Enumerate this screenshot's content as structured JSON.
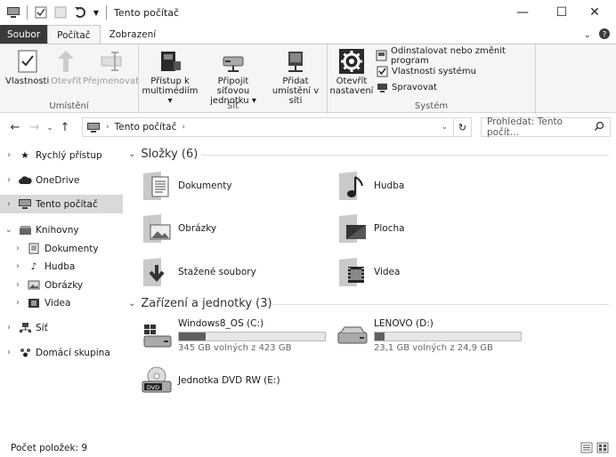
{
  "window": {
    "title": "Tento počítač"
  },
  "ribbon_tabs": [
    "Soubor",
    "Počítač",
    "Zobrazení"
  ],
  "ribbon": {
    "location_group": {
      "label": "Umístění",
      "properties": "Vlastnosti",
      "open": "Otevřít",
      "rename": "Přejmenovat"
    },
    "network_group": {
      "label": "Síť",
      "media_access_l1": "Přístup k",
      "media_access_l2": "multimédiím",
      "map_drive_l1": "Připojit síťovou",
      "map_drive_l2": "jednotku",
      "add_location_l1": "Přidat",
      "add_location_l2": "umístění v síti"
    },
    "system_group": {
      "label": "Systém",
      "open_settings_l1": "Otevřít",
      "open_settings_l2": "nastavení",
      "uninstall": "Odinstalovat nebo změnit program",
      "system_properties": "Vlastnosti systému",
      "manage": "Spravovat"
    }
  },
  "address": {
    "path": "Tento počítač",
    "search_placeholder": "Prohledat: Tento počít..."
  },
  "nav_pane": {
    "items": [
      {
        "label": "Rychlý přístup",
        "icon": "star-icon"
      },
      {
        "label": "OneDrive",
        "icon": "cloud-icon"
      },
      {
        "label": "Tento počítač",
        "icon": "computer-icon"
      },
      {
        "label": "Knihovny",
        "icon": "library-icon"
      },
      {
        "label": "Dokumenty",
        "icon": "documents-icon"
      },
      {
        "label": "Hudba",
        "icon": "music-icon"
      },
      {
        "label": "Obrázky",
        "icon": "pictures-icon"
      },
      {
        "label": "Videa",
        "icon": "videos-icon"
      },
      {
        "label": "Síť",
        "icon": "network-icon"
      },
      {
        "label": "Domácí skupina",
        "icon": "homegroup-icon"
      }
    ]
  },
  "folders_section": {
    "header": "Složky (6)",
    "items": [
      {
        "label": "Dokumenty",
        "icon": "documents-folder-icon"
      },
      {
        "label": "Hudba",
        "icon": "music-folder-icon"
      },
      {
        "label": "Obrázky",
        "icon": "pictures-folder-icon"
      },
      {
        "label": "Plocha",
        "icon": "desktop-folder-icon"
      },
      {
        "label": "Stažené soubory",
        "icon": "downloads-folder-icon"
      },
      {
        "label": "Videa",
        "icon": "videos-folder-icon"
      }
    ]
  },
  "drives_section": {
    "header": "Zařízení a jednotky (3)",
    "drives": [
      {
        "label": "Windows8_OS (C:)",
        "free": "345 GB volných z 423 GB",
        "used_fraction": 0.18
      },
      {
        "label": "LENOVO (D:)",
        "free": "23,1 GB volných z 24,9 GB",
        "used_fraction": 0.07
      }
    ],
    "dvd": {
      "label": "Jednotka DVD RW (E:)"
    }
  },
  "status": {
    "item_count": "Počet položek: 9"
  }
}
